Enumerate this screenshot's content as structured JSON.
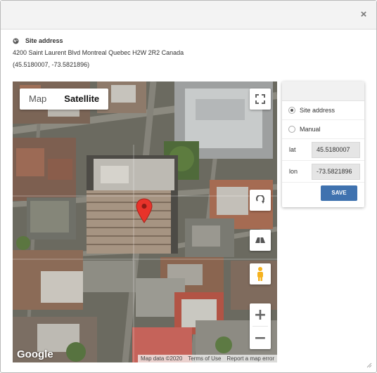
{
  "dialog": {
    "close_label": "×"
  },
  "address": {
    "title": "Site address",
    "line": "4200 Saint Laurent Blvd Montreal Quebec H2W 2R2 Canada",
    "coords": "(45.5180007, -73.5821896)"
  },
  "map": {
    "types": [
      {
        "label": "Map",
        "active": false
      },
      {
        "label": "Satellite",
        "active": true
      }
    ],
    "zoom_in": "+",
    "zoom_out": "−",
    "logo": "Google",
    "attribution": {
      "data": "Map data ©2020",
      "terms": "Terms of Use",
      "report": "Report a map error"
    },
    "icons": [
      "fullscreen-icon",
      "rotate-icon",
      "tilt-icon",
      "pegman-icon",
      "map-pin-icon"
    ]
  },
  "panel": {
    "options": [
      {
        "label": "Site address",
        "checked": true
      },
      {
        "label": "Manual",
        "checked": false
      }
    ],
    "lat_label": "lat",
    "lat_value": "45.5180007",
    "lon_label": "lon",
    "lon_value": "-73.5821896",
    "save_label": "SAVE"
  },
  "colors": {
    "save": "#3f72af",
    "pin": "#e8332a"
  }
}
